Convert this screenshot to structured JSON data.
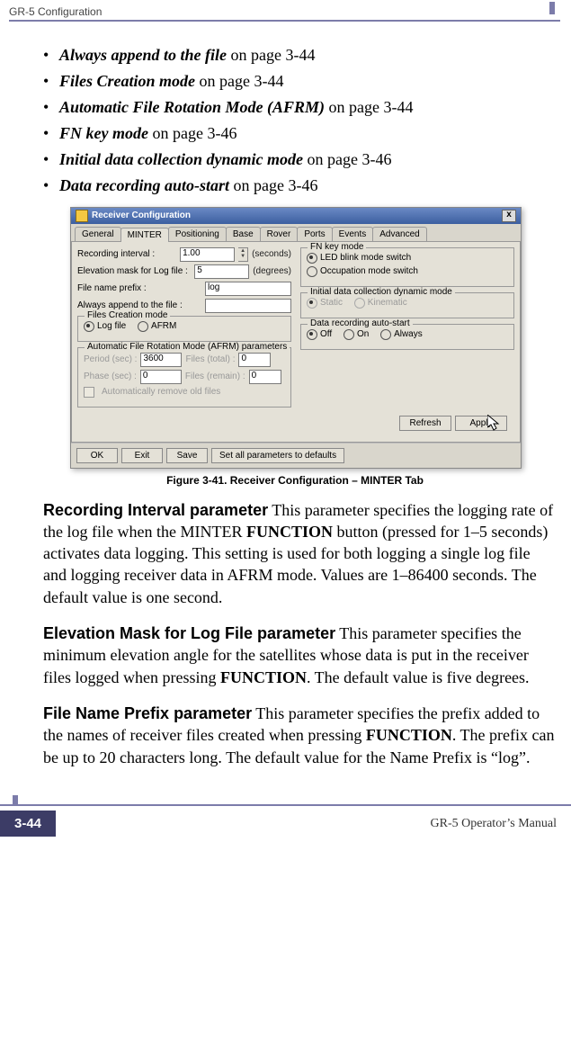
{
  "header": {
    "running_title": "GR-5 Configuration"
  },
  "bullets": [
    {
      "emph": "Always append to the file",
      "rest": " on page 3-44"
    },
    {
      "emph": "Files Creation mode",
      "rest": " on page 3-44"
    },
    {
      "emph": "Automatic File Rotation Mode (AFRM)",
      "rest": " on page 3-44"
    },
    {
      "emph": "FN key mode",
      "rest": " on page 3-46"
    },
    {
      "emph": "Initial data collection dynamic mode",
      "rest": " on page 3-46"
    },
    {
      "emph": "Data recording auto-start",
      "rest": " on page 3-46"
    }
  ],
  "window": {
    "title": "Receiver Configuration",
    "close": "x",
    "tabs": [
      "General",
      "MINTER",
      "Positioning",
      "Base",
      "Rover",
      "Ports",
      "Events",
      "Advanced"
    ],
    "active_tab": 1,
    "fields": {
      "recording_interval_label": "Recording interval :",
      "recording_interval_value": "1.00",
      "recording_interval_unit": "(seconds)",
      "elev_mask_label": "Elevation mask for Log file :",
      "elev_mask_value": "5",
      "elev_mask_unit": "(degrees)",
      "file_prefix_label": "File name prefix :",
      "file_prefix_value": "log",
      "always_append_label": "Always append to the file :",
      "always_append_value": ""
    },
    "files_creation": {
      "title": "Files Creation mode",
      "opt_log": "Log file",
      "opt_afrm": "AFRM"
    },
    "afrm": {
      "title": "Automatic File Rotation Mode (AFRM) parameters",
      "period_label": "Period (sec) :",
      "period_value": "3600",
      "files_total_label": "Files (total) :",
      "files_total_value": "0",
      "phase_label": "Phase (sec) :",
      "phase_value": "0",
      "files_remain_label": "Files (remain) :",
      "files_remain_value": "0",
      "auto_remove": "Automatically remove old files"
    },
    "fnkey": {
      "title": "FN key mode",
      "opt1": "LED blink mode switch",
      "opt2": "Occupation mode switch"
    },
    "initial_dynamic": {
      "title": "Initial data collection dynamic mode",
      "opt_static": "Static",
      "opt_kinematic": "Kinematic"
    },
    "auto_start": {
      "title": "Data recording auto-start",
      "opt_off": "Off",
      "opt_on": "On",
      "opt_always": "Always"
    },
    "buttons": {
      "refresh": "Refresh",
      "apply": "Apply",
      "ok": "OK",
      "exit": "Exit",
      "save": "Save",
      "defaults": "Set all parameters to defaults"
    }
  },
  "figure_caption": "Figure 3-41. Receiver Configuration – MINTER Tab",
  "para1": {
    "head": "Recording Interval parameter",
    "body_a": " This parameter specifies the logging rate of the log file when the MINTER ",
    "bold1": "FUNCTION",
    "body_b": " button (pressed for 1–5 seconds) activates data logging. This setting is used for both logging a single log file and logging receiver data in AFRM mode. Values are 1–86400 seconds. The default value is one second."
  },
  "para2": {
    "head": "Elevation Mask for Log File parameter",
    "body_a": " This parameter specifies the minimum elevation angle for the satellites whose data is put in the receiver files logged when pressing ",
    "bold1": "FUNCTION",
    "body_b": ". The default value is five degrees."
  },
  "para3": {
    "head": "File Name Prefix parameter",
    "body_a": " This parameter specifies the prefix added to the names of receiver files created when pressing ",
    "bold1": "FUNCTION",
    "body_b": ". The prefix can be up to 20 characters long. The default value for the Name Prefix is “log”."
  },
  "footer": {
    "page": "3-44",
    "manual": "GR-5 Operator’s Manual"
  }
}
